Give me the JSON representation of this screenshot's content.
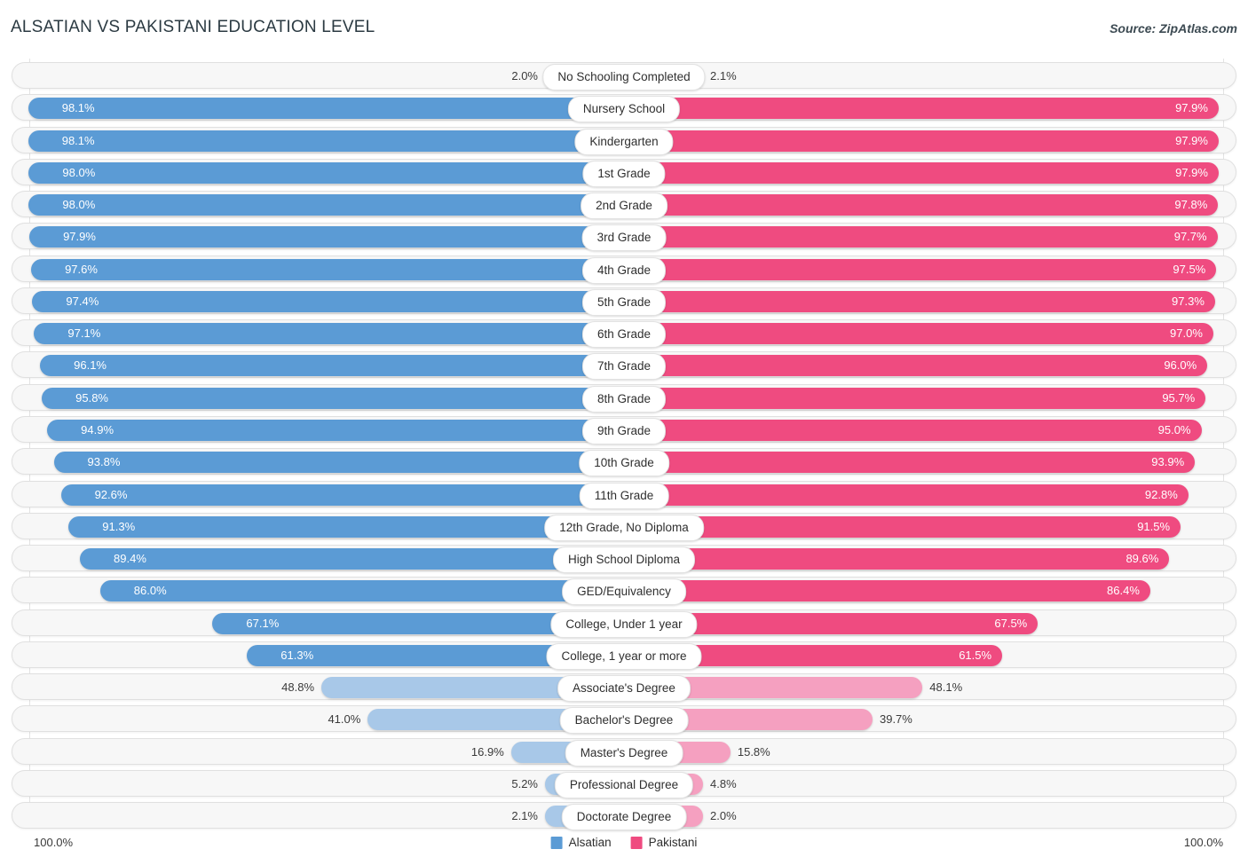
{
  "header": {
    "title": "ALSATIAN VS PAKISTANI EDUCATION LEVEL",
    "source": "Source: ZipAtlas.com"
  },
  "axis": {
    "left_max": "100.0%",
    "right_max": "100.0%"
  },
  "legend": {
    "items": [
      {
        "label": "Alsatian",
        "color": "#5b9bd5",
        "swatch": "legend-swatch-alsatian"
      },
      {
        "label": "Pakistani",
        "color": "#f2four",
        "swatch": "legend-swatch-pakistani"
      }
    ]
  },
  "colors": {
    "alsatian_strong": "#5b9bd5",
    "alsatian_light": "#a8c8e8",
    "pakistani_strong": "#f4partial",
    "pakistani_light": "#f5a0c0",
    "row_track": "#f7f7f7",
    "row_border": "#e0e0e0"
  },
  "chart_data": {
    "type": "bar",
    "title": "ALSATIAN VS PAKISTANI EDUCATION LEVEL",
    "subtitle": "",
    "xlabel": "",
    "ylabel": "",
    "orientation": "horizontal-diverging",
    "xlim": [
      0,
      100
    ],
    "grid": true,
    "legend_position": "bottom-center",
    "series": [
      {
        "name": "Alsatian",
        "side": "left",
        "color": "#5b9bd5",
        "values": [
          2.0,
          98.1,
          98.1,
          98.0,
          98.0,
          97.9,
          97.6,
          97.4,
          97.1,
          96.1,
          95.8,
          94.9,
          93.8,
          92.6,
          91.3,
          89.4,
          86.0,
          67.1,
          61.3,
          48.8,
          41.0,
          16.9,
          5.2,
          2.1
        ]
      },
      {
        "name": "Pakistani",
        "side": "right",
        "color": "#f0477d",
        "values": [
          2.1,
          97.9,
          97.9,
          97.9,
          97.8,
          97.7,
          97.5,
          97.3,
          97.0,
          96.0,
          95.7,
          95.0,
          93.9,
          92.8,
          91.5,
          89.6,
          86.4,
          67.5,
          61.5,
          48.1,
          39.7,
          15.8,
          4.8,
          2.0
        ]
      }
    ],
    "categories": [
      "No Schooling Completed",
      "Nursery School",
      "Kindergarten",
      "1st Grade",
      "2nd Grade",
      "3rd Grade",
      "4th Grade",
      "5th Grade",
      "6th Grade",
      "7th Grade",
      "8th Grade",
      "9th Grade",
      "10th Grade",
      "11th Grade",
      "12th Grade, No Diploma",
      "High School Diploma",
      "GED/Equivalency",
      "College, Under 1 year",
      "College, 1 year or more",
      "Associate's Degree",
      "Bachelor's Degree",
      "Master's Degree",
      "Professional Degree",
      "Doctorate Degree"
    ]
  },
  "rows": [
    {
      "label": "No Schooling Completed",
      "left": "2.0%",
      "right": "2.1%",
      "left_val": 2.0,
      "right_val": 2.1
    },
    {
      "label": "Nursery School",
      "left": "98.1%",
      "right": "97.9%",
      "left_val": 98.1,
      "right_val": 97.9
    },
    {
      "label": "Kindergarten",
      "left": "98.1%",
      "right": "97.9%",
      "left_val": 98.1,
      "right_val": 97.9
    },
    {
      "label": "1st Grade",
      "left": "98.0%",
      "right": "97.9%",
      "left_val": 98.0,
      "right_val": 97.9
    },
    {
      "label": "2nd Grade",
      "left": "98.0%",
      "right": "97.8%",
      "left_val": 98.0,
      "right_val": 97.8
    },
    {
      "label": "3rd Grade",
      "left": "97.9%",
      "right": "97.7%",
      "left_val": 97.9,
      "right_val": 97.7
    },
    {
      "label": "4th Grade",
      "left": "97.6%",
      "right": "97.5%",
      "left_val": 97.6,
      "right_val": 97.5
    },
    {
      "label": "5th Grade",
      "left": "97.4%",
      "right": "97.3%",
      "left_val": 97.4,
      "right_val": 97.3
    },
    {
      "label": "6th Grade",
      "left": "97.1%",
      "right": "97.0%",
      "left_val": 97.1,
      "right_val": 97.0
    },
    {
      "label": "7th Grade",
      "left": "96.1%",
      "right": "96.0%",
      "left_val": 96.1,
      "right_val": 96.0
    },
    {
      "label": "8th Grade",
      "left": "95.8%",
      "right": "95.7%",
      "left_val": 95.8,
      "right_val": 95.7
    },
    {
      "label": "9th Grade",
      "left": "94.9%",
      "right": "95.0%",
      "left_val": 94.9,
      "right_val": 95.0
    },
    {
      "label": "10th Grade",
      "left": "93.8%",
      "right": "93.9%",
      "left_val": 93.8,
      "right_val": 93.9
    },
    {
      "label": "11th Grade",
      "left": "92.6%",
      "right": "92.8%",
      "left_val": 92.6,
      "right_val": 92.8
    },
    {
      "label": "12th Grade, No Diploma",
      "left": "91.3%",
      "right": "91.5%",
      "left_val": 91.3,
      "right_val": 91.5
    },
    {
      "label": "High School Diploma",
      "left": "89.4%",
      "right": "89.6%",
      "left_val": 89.4,
      "right_val": 89.6
    },
    {
      "label": "GED/Equivalency",
      "left": "86.0%",
      "right": "86.4%",
      "left_val": 86.0,
      "right_val": 86.4
    },
    {
      "label": "College, Under 1 year",
      "left": "67.1%",
      "right": "67.5%",
      "left_val": 67.1,
      "right_val": 67.5
    },
    {
      "label": "College, 1 year or more",
      "left": "61.3%",
      "right": "61.5%",
      "left_val": 61.3,
      "right_val": 61.5
    },
    {
      "label": "Associate's Degree",
      "left": "48.8%",
      "right": "48.1%",
      "left_val": 48.8,
      "right_val": 48.1
    },
    {
      "label": "Bachelor's Degree",
      "left": "41.0%",
      "right": "39.7%",
      "left_val": 41.0,
      "right_val": 39.7
    },
    {
      "label": "Master's Degree",
      "left": "16.9%",
      "right": "15.8%",
      "left_val": 16.9,
      "right_val": 15.8
    },
    {
      "label": "Professional Degree",
      "left": "5.2%",
      "right": "4.8%",
      "left_val": 5.2,
      "right_val": 4.8
    },
    {
      "label": "Doctorate Degree",
      "left": "2.1%",
      "right": "2.0%",
      "left_val": 2.1,
      "right_val": 2.0
    }
  ]
}
